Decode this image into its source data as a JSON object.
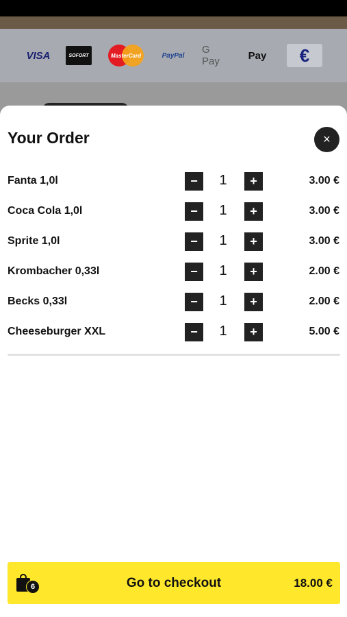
{
  "payment_methods": {
    "visa": "VISA",
    "sofort": "SOFORT",
    "mastercard": "MasterCard",
    "paypal": "PayPal",
    "gpay": "G Pay",
    "applepay": " Pay",
    "cash": "€"
  },
  "order": {
    "title": "Your Order",
    "close_icon": "×",
    "items": [
      {
        "name": "Fanta 1,0l",
        "qty": "1",
        "price": "3.00 €"
      },
      {
        "name": "Coca Cola 1,0l",
        "qty": "1",
        "price": "3.00 €"
      },
      {
        "name": "Sprite 1,0l",
        "qty": "1",
        "price": "3.00 €"
      },
      {
        "name": "Krombacher 0,33l",
        "qty": "1",
        "price": "2.00 €"
      },
      {
        "name": "Becks 0,33l",
        "qty": "1",
        "price": "2.00 €"
      },
      {
        "name": "Cheeseburger XXL",
        "qty": "1",
        "price": "5.00 €"
      }
    ],
    "minus_symbol": "−",
    "plus_symbol": "+"
  },
  "checkout": {
    "badge_count": "6",
    "label": "Go to checkout",
    "total": "18.00 €"
  },
  "colors": {
    "accent": "#ffe82b",
    "dark": "#222222"
  }
}
